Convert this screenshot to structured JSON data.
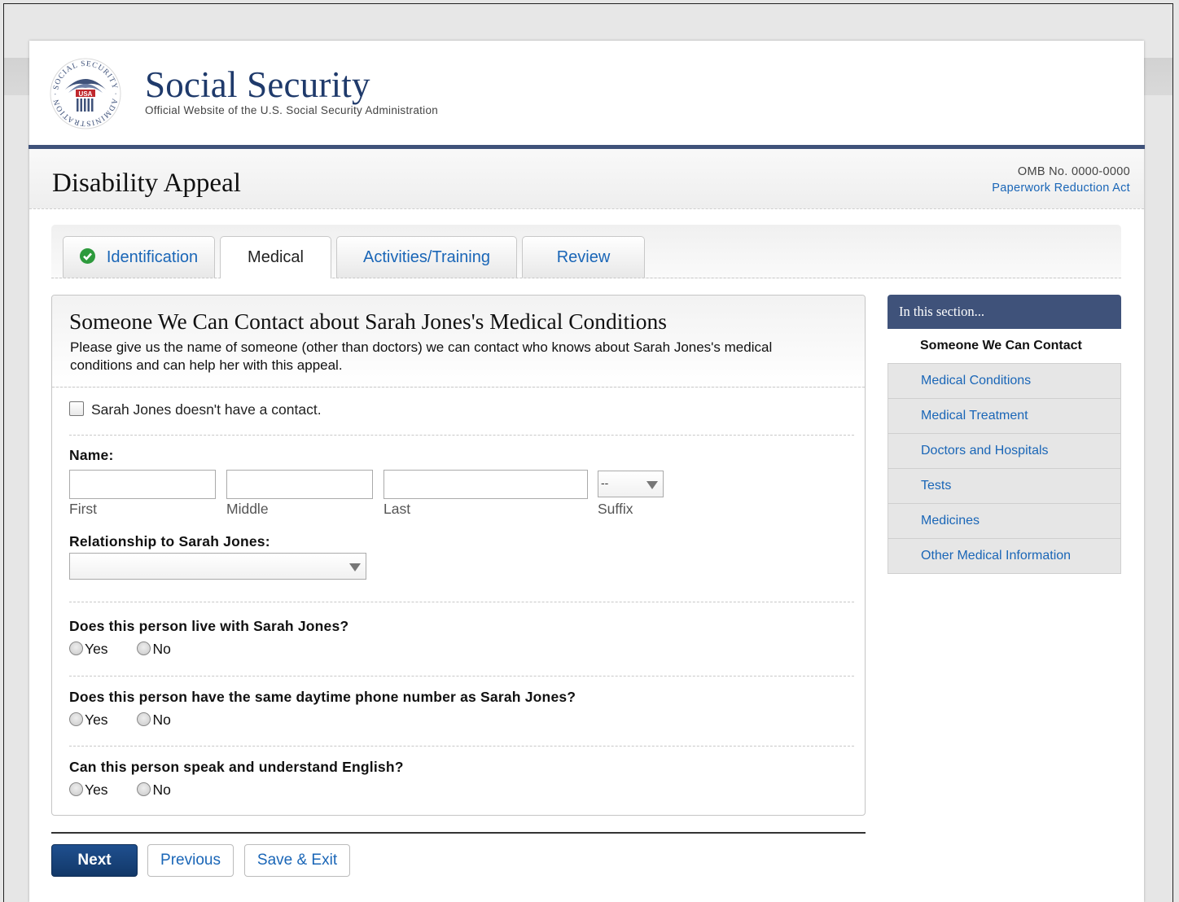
{
  "header": {
    "title": "Social Security",
    "subtitle": "Official Website of the U.S. Social Security Administration",
    "logo_text": "SOCIAL SECURITY ADMINISTRATION USA"
  },
  "titlebar": {
    "page_title": "Disability Appeal",
    "omb": "OMB No. 0000-0000",
    "pra_link": "Paperwork Reduction Act"
  },
  "tabs": [
    {
      "label": "Identification",
      "state": "complete"
    },
    {
      "label": "Medical",
      "state": "active"
    },
    {
      "label": "Activities/Training",
      "state": "default"
    },
    {
      "label": "Review",
      "state": "default"
    }
  ],
  "section": {
    "title": "Someone We Can Contact about Sarah Jones's Medical Conditions",
    "description": "Please give us the name of someone (other than doctors) we can contact who knows about Sarah Jones's medical conditions and can help her with this appeal.",
    "no_contact_label": "Sarah Jones doesn't have a contact.",
    "name_label": "Name:",
    "first_label": "First",
    "middle_label": "Middle",
    "last_label": "Last",
    "suffix_label": "Suffix",
    "suffix_value": "--",
    "first_value": "",
    "middle_value": "",
    "last_value": "",
    "relationship_label": "Relationship to Sarah Jones:",
    "relationship_value": "",
    "questions": [
      {
        "text": "Does this person live with Sarah Jones?",
        "yes": "Yes",
        "no": "No"
      },
      {
        "text": "Does this person have the same daytime phone number as Sarah Jones?",
        "yes": "Yes",
        "no": "No"
      },
      {
        "text": "Can this person speak and understand English?",
        "yes": "Yes",
        "no": "No"
      }
    ]
  },
  "sidebar": {
    "heading": "In this section...",
    "items": [
      {
        "label": "Someone We Can Contact",
        "current": true
      },
      {
        "label": "Medical Conditions",
        "current": false
      },
      {
        "label": "Medical Treatment",
        "current": false
      },
      {
        "label": "Doctors and Hospitals",
        "current": false
      },
      {
        "label": "Tests",
        "current": false
      },
      {
        "label": "Medicines",
        "current": false
      },
      {
        "label": "Other Medical Information",
        "current": false
      }
    ]
  },
  "buttons": {
    "next": "Next",
    "previous": "Previous",
    "save_exit": "Save & Exit"
  },
  "colors": {
    "brand_navy": "#3f527a",
    "link_blue": "#1a66b7",
    "complete_green": "#2d9a3c",
    "primary_button": "#1f4f8f"
  }
}
